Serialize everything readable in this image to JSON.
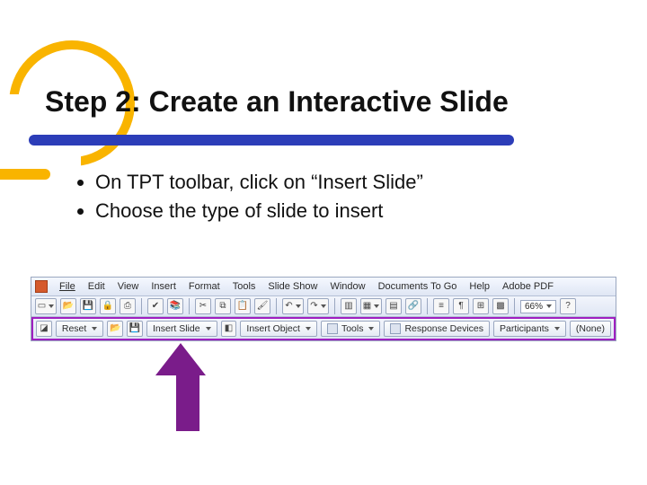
{
  "title": "Step 2: Create an Interactive Slide",
  "bullets": [
    "On TPT toolbar, click on “Insert Slide”",
    "Choose the type of slide to insert"
  ],
  "menubar": {
    "items": [
      "File",
      "Edit",
      "View",
      "Insert",
      "Format",
      "Tools",
      "Slide Show",
      "Window",
      "Documents To Go",
      "Help",
      "Adobe PDF"
    ]
  },
  "standard_toolbar": {
    "zoom": "66%"
  },
  "tpt_toolbar": {
    "reset": "Reset",
    "insert_slide": "Insert Slide",
    "insert_object": "Insert Object",
    "tools": "Tools",
    "response_devices": "Response Devices",
    "participants": "Participants",
    "participants_value": "(None)"
  }
}
